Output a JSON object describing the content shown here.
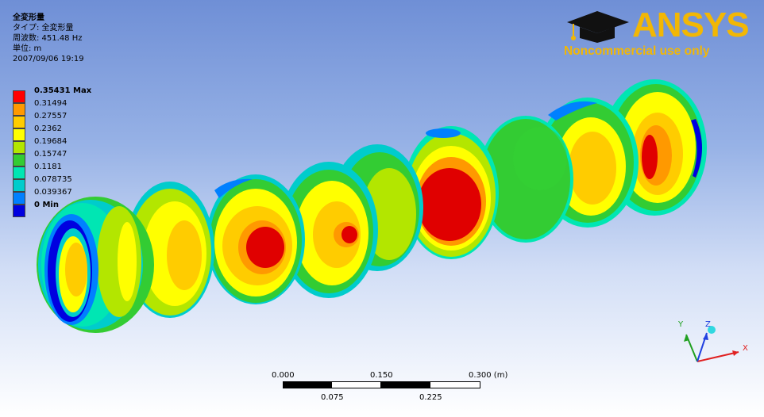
{
  "result": {
    "title": "全変形量",
    "type_line": "タイプ: 全変形量",
    "frequency_line": "周波数: 451.48 Hz",
    "unit_line": "単位: m",
    "date_line": "2007/09/06 19:19"
  },
  "legend": {
    "entries": [
      {
        "label": "0.35431 Max",
        "color": "#ff0000",
        "bold": true
      },
      {
        "label": "0.31494",
        "color": "#ff9900",
        "bold": false
      },
      {
        "label": "0.27557",
        "color": "#ffcc00",
        "bold": false
      },
      {
        "label": "0.2362",
        "color": "#ffff00",
        "bold": false
      },
      {
        "label": "0.19684",
        "color": "#b3e600",
        "bold": false
      },
      {
        "label": "0.15747",
        "color": "#33cc33",
        "bold": false
      },
      {
        "label": "0.1181",
        "color": "#00e6b3",
        "bold": false
      },
      {
        "label": "0.078735",
        "color": "#00cccc",
        "bold": false
      },
      {
        "label": "0.039367",
        "color": "#0080ff",
        "bold": false
      },
      {
        "label": "0 Min",
        "color": "#0000e0",
        "bold": true
      }
    ]
  },
  "logo": {
    "brand": "ANSYS",
    "notice": "Noncommercial use only",
    "color": "#f2b705"
  },
  "scale_bar": {
    "top_ticks": [
      "0.000",
      "0.150",
      "0.300 (m)"
    ],
    "bottom_ticks": [
      "0.075",
      "0.225"
    ]
  },
  "triad": {
    "x_label": "X",
    "y_label": "Y",
    "z_label": "Z"
  }
}
